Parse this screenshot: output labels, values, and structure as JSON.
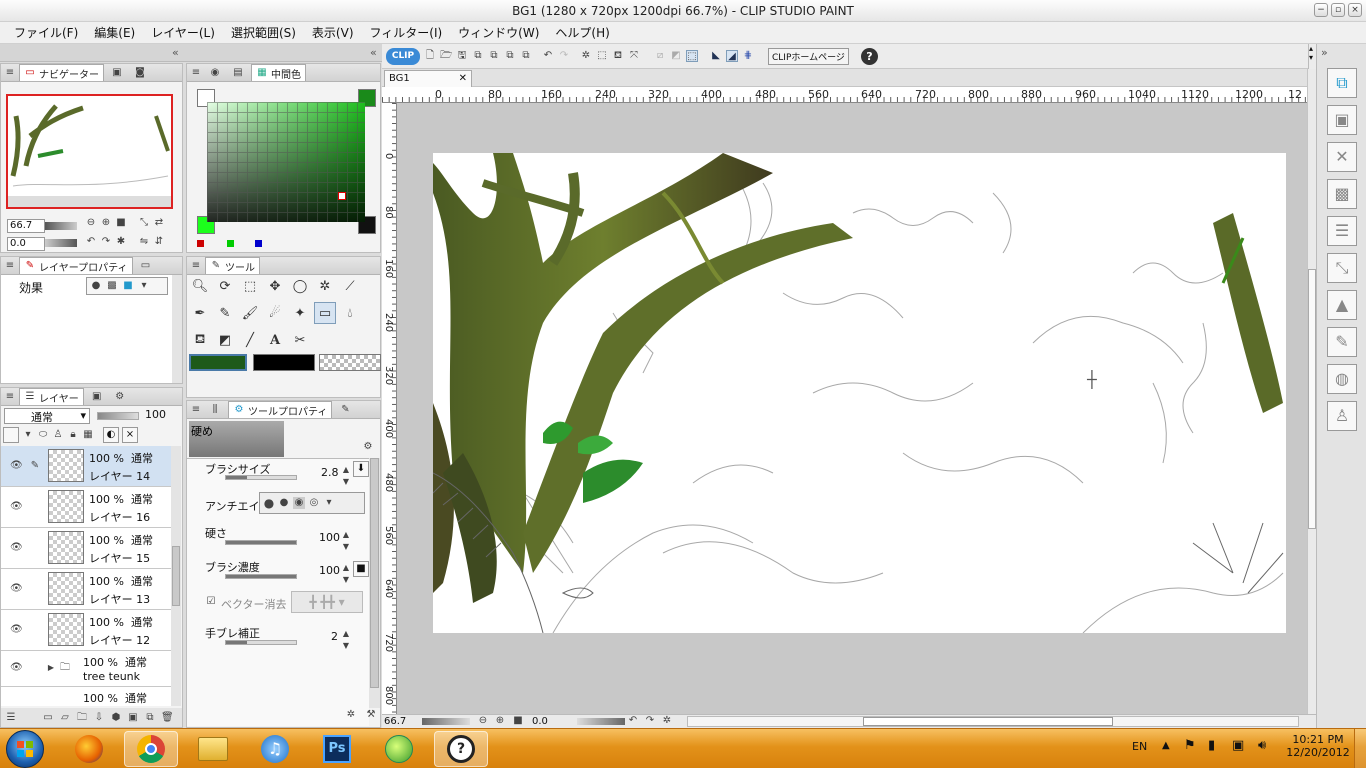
{
  "window": {
    "title": "BG1 (1280 x 720px 1200dpi 66.7%)  - CLIP STUDIO PAINT"
  },
  "menu": [
    "ファイル(F)",
    "編集(E)",
    "レイヤー(L)",
    "選択範囲(S)",
    "表示(V)",
    "フィルター(I)",
    "ウィンドウ(W)",
    "ヘルプ(H)"
  ],
  "navigator": {
    "tab": "ナビゲーター",
    "zoom": "66.7",
    "rotation": "0.0"
  },
  "color": {
    "tab": "中間色",
    "main_color": "#1e5a1a",
    "sub_color": "#000000"
  },
  "layer_property": {
    "tab": "レイヤープロパティ",
    "effect_label": "効果"
  },
  "tool": {
    "tab": "ツール"
  },
  "tool_property": {
    "tab": "ツールプロパティ",
    "subtool": "硬め",
    "brush_size_label": "ブラシサイズ",
    "brush_size": "2.8",
    "antialias_label": "アンチエイリ",
    "hardness_label": "硬さ",
    "hardness": "100",
    "density_label": "ブラシ濃度",
    "density": "100",
    "vector_erase_label": "ベクター消去",
    "stabilization_label": "手ブレ補正",
    "stabilization": "2"
  },
  "layers": {
    "tab": "レイヤー",
    "blend_mode": "通常",
    "opacity": "100",
    "items": [
      {
        "opacity": "100 %",
        "mode": "通常",
        "name": "レイヤー 14",
        "selected": true
      },
      {
        "opacity": "100 %",
        "mode": "通常",
        "name": "レイヤー 16"
      },
      {
        "opacity": "100 %",
        "mode": "通常",
        "name": "レイヤー 15"
      },
      {
        "opacity": "100 %",
        "mode": "通常",
        "name": "レイヤー 13"
      },
      {
        "opacity": "100 %",
        "mode": "通常",
        "name": "レイヤー 12"
      },
      {
        "opacity": "100 %",
        "mode": "通常",
        "name": "tree teunk"
      },
      {
        "opacity": "100 %",
        "mode": "通常",
        "name": ""
      }
    ]
  },
  "toolbar": {
    "clip_home": "CLIPホームページ",
    "help": "?"
  },
  "canvas": {
    "tab": "BG1",
    "h_ruler": [
      "0",
      "80",
      "160",
      "240",
      "320",
      "400",
      "480",
      "560",
      "640",
      "720",
      "800",
      "880",
      "960",
      "1040",
      "1120",
      "1200",
      "12"
    ],
    "v_ruler": [
      "0",
      "80",
      "160",
      "240",
      "320",
      "400",
      "480",
      "560",
      "640",
      "720",
      "800"
    ],
    "status_zoom": "66.7",
    "status_rotation": "0.0"
  },
  "taskbar": {
    "language": "EN",
    "time": "10:21 PM",
    "date": "12/20/2012",
    "apps": [
      "firefox-icon",
      "chrome-icon",
      "explorer-icon",
      "itunes-icon",
      "photoshop-icon",
      "sai-icon",
      "clip-studio-icon"
    ],
    "ps_label": "Ps"
  }
}
